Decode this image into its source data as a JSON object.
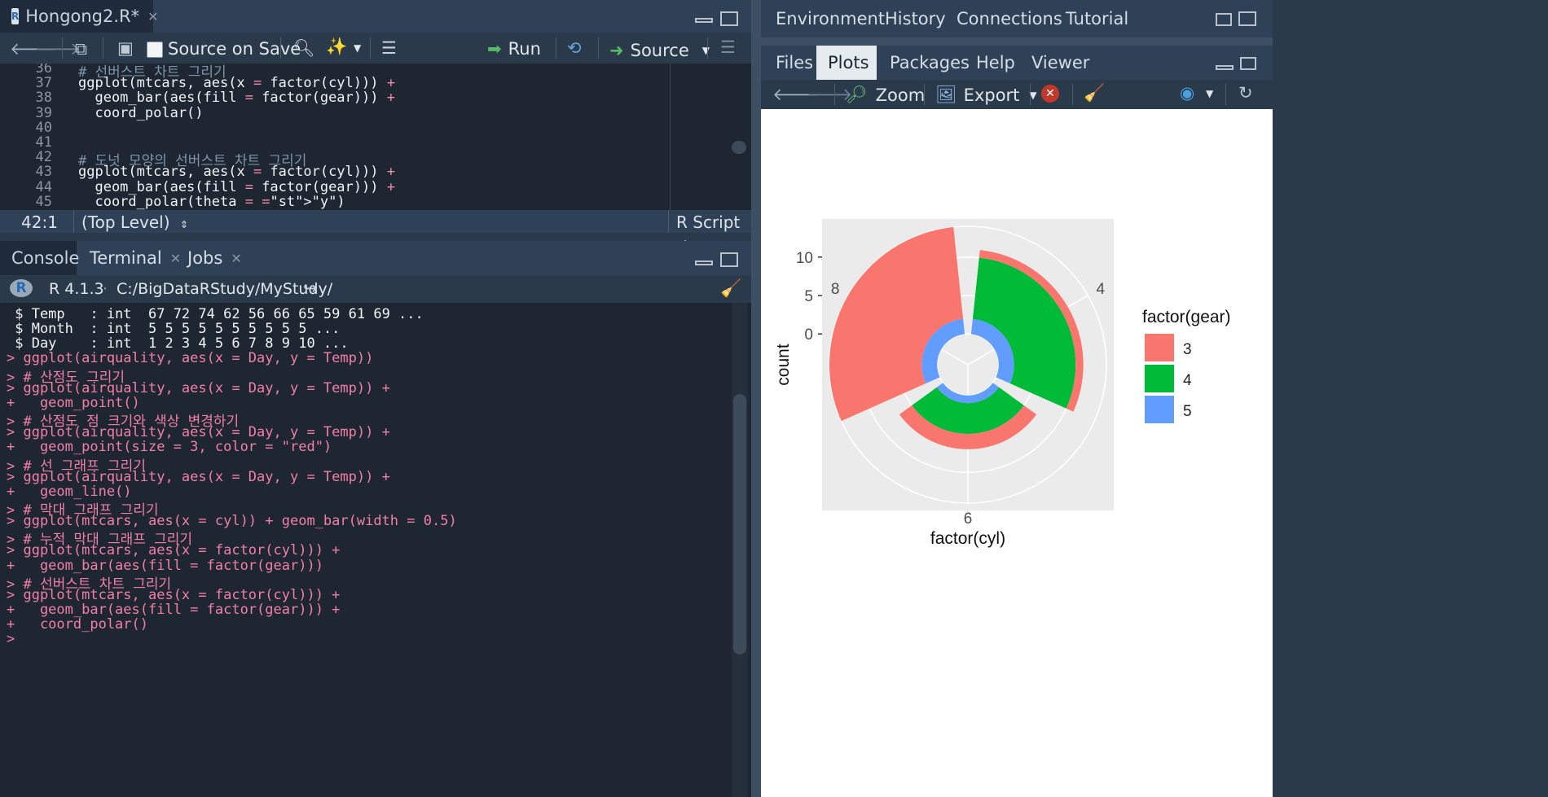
{
  "editor": {
    "file_tab": "Hongong2.R*",
    "source_on_save": "Source on Save",
    "run_label": "Run",
    "source_label": "Source",
    "lines": [
      {
        "n": "36",
        "t": "# 선버스트 차트 그리기"
      },
      {
        "n": "37",
        "t": "ggplot(mtcars, aes(x = factor(cyl))) +"
      },
      {
        "n": "38",
        "t": "  geom_bar(aes(fill = factor(gear))) +"
      },
      {
        "n": "39",
        "t": "  coord_polar()"
      },
      {
        "n": "40",
        "t": ""
      },
      {
        "n": "41",
        "t": ""
      },
      {
        "n": "42",
        "t": "# 도넛 모양의 선버스트 차트 그리기"
      },
      {
        "n": "43",
        "t": "ggplot(mtcars, aes(x = factor(cyl))) +"
      },
      {
        "n": "44",
        "t": "  geom_bar(aes(fill = factor(gear))) +"
      },
      {
        "n": "45",
        "t": "  coord_polar(theta = \"y\")"
      }
    ],
    "status": {
      "position": "42:1",
      "scope": "(Top Level)",
      "type": "R Script"
    }
  },
  "console": {
    "tabs": [
      "Console",
      "Terminal",
      "Jobs"
    ],
    "r_version": "R 4.1.3",
    "path": "C:/BigDataRStudy/MyStudy/",
    "lines": [
      {
        "k": "out",
        "t": " $ Temp   : int  67 72 74 62 56 66 65 59 61 69 ..."
      },
      {
        "k": "out",
        "t": " $ Month  : int  5 5 5 5 5 5 5 5 5 5 ..."
      },
      {
        "k": "out",
        "t": " $ Day    : int  1 2 3 4 5 6 7 8 9 10 ..."
      },
      {
        "k": "cmd",
        "t": "> ggplot(airquality, aes(x = Day, y = Temp))"
      },
      {
        "k": "cmd",
        "t": "> # 산점도 그리기"
      },
      {
        "k": "cmd",
        "t": "> ggplot(airquality, aes(x = Day, y = Temp)) +"
      },
      {
        "k": "cmd",
        "t": "+   geom_point()"
      },
      {
        "k": "cmd",
        "t": "> # 산점도 점 크기와 색상 변경하기"
      },
      {
        "k": "cmd",
        "t": "> ggplot(airquality, aes(x = Day, y = Temp)) +"
      },
      {
        "k": "cmd",
        "t": "+   geom_point(size = 3, color = \"red\")"
      },
      {
        "k": "cmd",
        "t": "> # 선 그래프 그리기"
      },
      {
        "k": "cmd",
        "t": "> ggplot(airquality, aes(x = Day, y = Temp)) +"
      },
      {
        "k": "cmd",
        "t": "+   geom_line()"
      },
      {
        "k": "cmd",
        "t": "> # 막대 그래프 그리기"
      },
      {
        "k": "cmd",
        "t": "> ggplot(mtcars, aes(x = cyl)) + geom_bar(width = 0.5)"
      },
      {
        "k": "cmd",
        "t": "> # 누적 막대 그래프 그리기"
      },
      {
        "k": "cmd",
        "t": "> ggplot(mtcars, aes(x = factor(cyl))) +"
      },
      {
        "k": "cmd",
        "t": "+   geom_bar(aes(fill = factor(gear)))"
      },
      {
        "k": "cmd",
        "t": "> # 선버스트 차트 그리기"
      },
      {
        "k": "cmd",
        "t": "> ggplot(mtcars, aes(x = factor(cyl))) +"
      },
      {
        "k": "cmd",
        "t": "+   geom_bar(aes(fill = factor(gear))) +"
      },
      {
        "k": "cmd",
        "t": "+   coord_polar()"
      },
      {
        "k": "cmd",
        "t": ">"
      }
    ]
  },
  "env_tabs": [
    "Environment",
    "History",
    "Connections",
    "Tutorial"
  ],
  "files_tabs": [
    "Files",
    "Plots",
    "Packages",
    "Help",
    "Viewer"
  ],
  "plot_toolbar": {
    "zoom": "Zoom",
    "export": "Export"
  },
  "colors": {
    "gear3": "#F8766D",
    "gear4": "#00BA38",
    "gear5": "#619CFF",
    "panel_bg": "#EBEBEB"
  },
  "chart_data": {
    "type": "bar",
    "coord": "polar",
    "categories": [
      "4",
      "6",
      "8"
    ],
    "series": [
      {
        "name": "3",
        "values": [
          1,
          2,
          12
        ]
      },
      {
        "name": "4",
        "values": [
          8,
          4,
          0
        ]
      },
      {
        "name": "5",
        "values": [
          2,
          1,
          2
        ]
      }
    ],
    "xlabel": "factor(cyl)",
    "ylabel": "count",
    "y_ticks": [
      "0",
      "5",
      "10"
    ],
    "ylim": [
      -4,
      14
    ],
    "legend_title": "factor(gear)",
    "legend_position": "right"
  }
}
